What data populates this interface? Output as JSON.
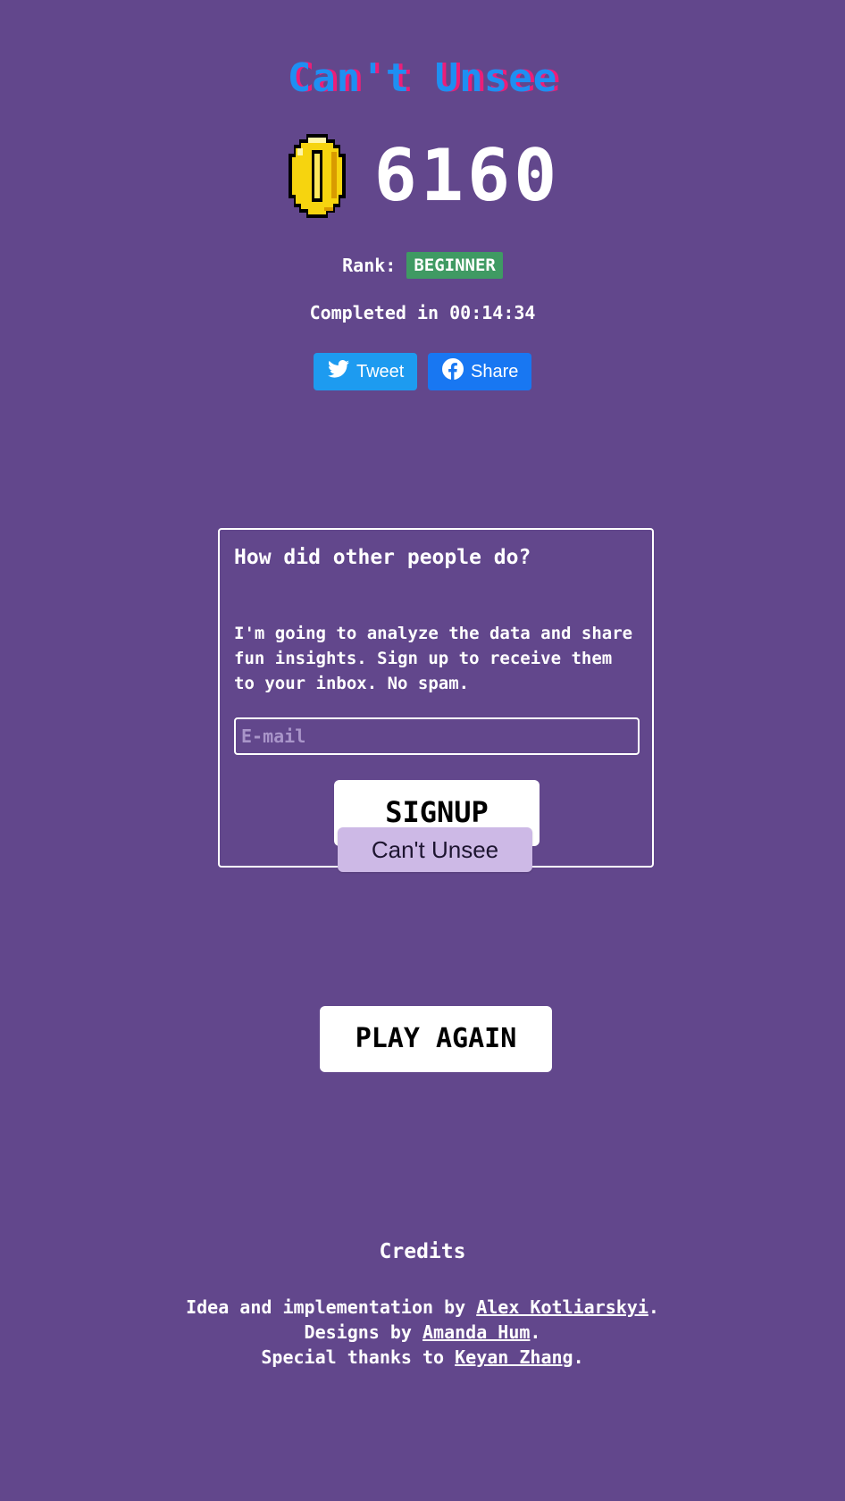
{
  "app": {
    "title": "Can't Unsee"
  },
  "result": {
    "score": "6160",
    "rank_label": "Rank:",
    "rank_value": "BEGINNER",
    "completed_prefix": "Completed in",
    "time": "00:14:34"
  },
  "share": {
    "tweet_label": "Tweet",
    "facebook_label": "Share"
  },
  "signup": {
    "heading": "How did other people do?",
    "description": "I'm going to analyze the data and share fun insights. Sign up to receive them to your inbox. No spam.",
    "email_placeholder": "E-mail",
    "button_label": "SIGNUP"
  },
  "tooltip": {
    "text": "Can't Unsee"
  },
  "play_again": {
    "label": "PLAY AGAIN"
  },
  "credits": {
    "heading": "Credits",
    "line1_prefix": "Idea and implementation by",
    "line1_link": "Alex Kotliarskyi",
    "line2_prefix": "Designs by",
    "line2_link": "Amanda Hum",
    "line3_prefix": "Special thanks to",
    "line3_link": "Keyan Zhang",
    "suffix": "."
  },
  "icons": {
    "coin": "coin-icon",
    "twitter": "twitter-bird-icon",
    "facebook": "facebook-icon"
  },
  "colors": {
    "background": "#62478c",
    "title_blue": "#1e8ff2",
    "title_pink": "#ec1e78",
    "rank_badge": "#3f9a63",
    "tweet_button": "#1d9bf0",
    "facebook_button": "#1877f2",
    "tooltip_bg": "#cdb9e6"
  }
}
